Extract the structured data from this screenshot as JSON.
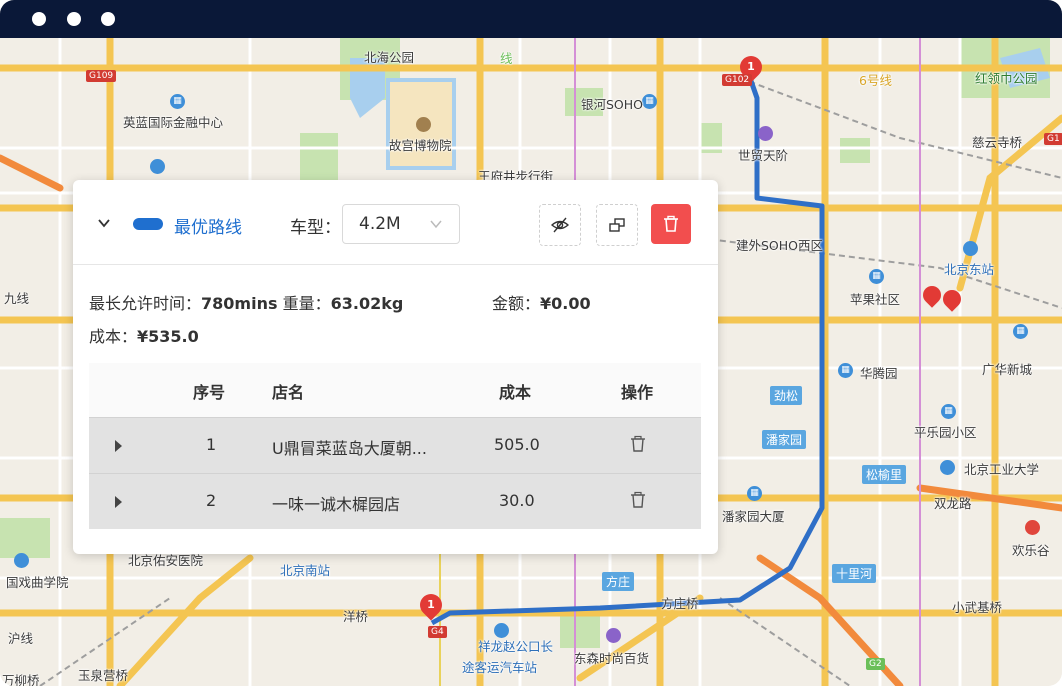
{
  "map": {
    "labels": {
      "beihai_park": "北海公园",
      "forbidden_city": "故宫博物院",
      "wangfujing": "王府井步行街",
      "yinglan": "英蓝国际金融中心",
      "yinhe_soho": "银河SOHO",
      "shimao": "世贸天阶",
      "jianwai_soho": "建外SOHO西区",
      "beijing_east_station": "北京东站",
      "pingguo": "苹果社区",
      "huateng": "华腾园",
      "guangsha": "广华新城",
      "jinsong": "劲松",
      "panjiayuan_badge": "潘家园",
      "pingle": "平乐园小区",
      "songyu": "松榆里",
      "bjut": "北京工业大学",
      "panjiayuan_east": "潘家园大厦",
      "shuanglong": "双龙路",
      "huanlegu": "欢乐谷",
      "shilihe": "十里河",
      "fangzhuang": "方庄",
      "fangzhuang_bridge": "方庄桥",
      "xiaowuji": "小武基桥",
      "yangqiao": "洋桥",
      "beijing_south": "北京南站",
      "youan": "北京佑安医院",
      "opera": "国戏曲学院",
      "xianglong": "祥龙赵公口长",
      "bus_station": "途客运汽车站",
      "dongsen": "东森时尚百货",
      "yuquanying": "玉泉营桥",
      "wanliu": "万柳桥",
      "hongling": "红领巾公园",
      "ciyun": "慈云寺桥",
      "ring6": "6号线",
      "ring9": "九线",
      "huxian": "沪线",
      "line_label": "线",
      "g109": "G109",
      "g102": "G102",
      "g4": "G4",
      "g2": "G2",
      "g1": "G1"
    },
    "pins": {
      "start": "1",
      "end": "1"
    }
  },
  "panel": {
    "route_name": "最优路线",
    "vehicle_label": "车型：",
    "vehicle_value": "4.2M",
    "info": {
      "max_time_label": "最长允许时间：",
      "max_time_value": "780mins",
      "weight_label": "重量：",
      "weight_value": "63.02kg",
      "amount_label": "金额：",
      "amount_value": "¥0.00",
      "cost_label": "成本：",
      "cost_value": "¥535.0"
    },
    "table": {
      "headers": {
        "index": "序号",
        "store": "店名",
        "cost": "成本",
        "action": "操作"
      },
      "rows": [
        {
          "index": "1",
          "store": "U鼎冒菜蓝岛大厦朝...",
          "cost": "505.0"
        },
        {
          "index": "2",
          "store": "一味一诚木樨园店",
          "cost": "30.0"
        }
      ]
    }
  },
  "colors": {
    "titlebar": "#0a1838",
    "route": "#2f6fc7",
    "accent": "#1f6fcf",
    "delete": "#f24e4e"
  }
}
